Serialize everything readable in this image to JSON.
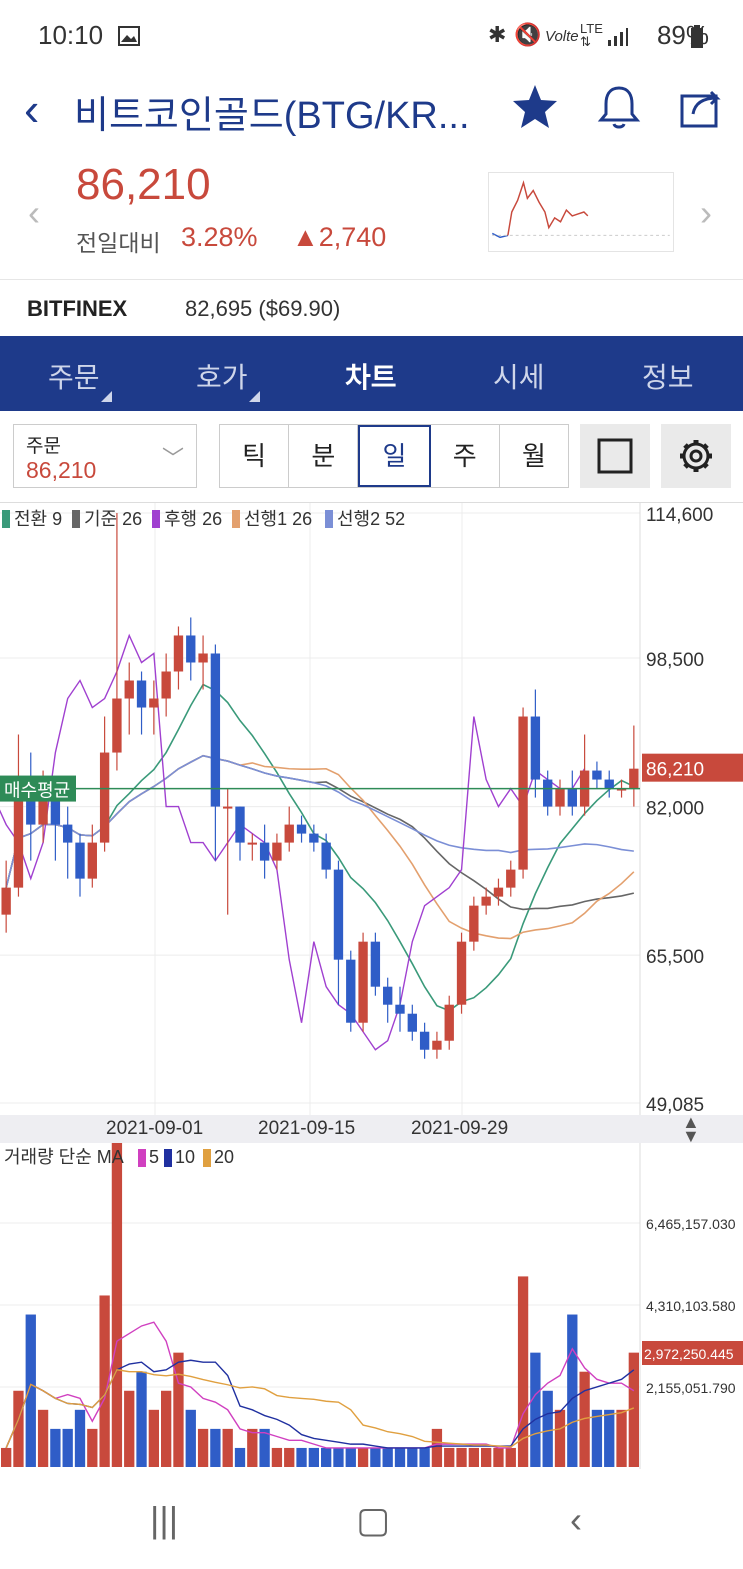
{
  "status_bar": {
    "time": "10:10",
    "battery": "89%",
    "icons": [
      "image-icon",
      "bluetooth-icon",
      "mute-icon",
      "volte-icon",
      "lte-icon",
      "signal-icon",
      "battery-icon"
    ]
  },
  "header": {
    "title": "비트코인골드(BTG/KR...",
    "icons": [
      "star-icon",
      "bell-icon",
      "share-icon"
    ]
  },
  "quote": {
    "price": "86,210",
    "change_label": "전일대비",
    "change_pct": "3.28%",
    "change_amount": "▲2,740",
    "up_color": "#c8493c",
    "down_color": "#2f5dc7"
  },
  "exchange": {
    "name": "BITFINEX",
    "value": "82,695 ($69.90)"
  },
  "tabs": [
    {
      "label": "주문"
    },
    {
      "label": "호가"
    },
    {
      "label": "차트"
    },
    {
      "label": "시세"
    },
    {
      "label": "정보"
    }
  ],
  "controls": {
    "order_label": "주문",
    "order_price": "86,210",
    "periods": [
      "틱",
      "분",
      "일",
      "주",
      "월"
    ],
    "selected_period": "일"
  },
  "price_chart": {
    "legend": [
      "전환 9",
      "기준 26",
      "후행 26",
      "선행1 26",
      "선행2 52"
    ],
    "y_labels": [
      "114,600",
      "98,500",
      "82,000",
      "65,500",
      "49,085"
    ],
    "current_price_label": "86,210",
    "avg_buy_label": "매수평균",
    "x_labels": [
      "2021-09-01",
      "2021-09-15",
      "2021-09-29"
    ]
  },
  "volume_chart": {
    "title": "거래량 단순 MA",
    "ma_labels": [
      "5",
      "10",
      "20"
    ],
    "y_labels": [
      "6,465,157.030",
      "4,310,103.580",
      "2,155,051.790"
    ],
    "current_label": "2,972,250.445"
  },
  "chart_data": {
    "type": "candlestick",
    "ylim": [
      49085,
      114600
    ],
    "candles": [
      [
        70000,
        73000,
        76000,
        68000
      ],
      [
        73000,
        84000,
        90000,
        72000
      ],
      [
        84000,
        80000,
        88000,
        76000
      ],
      [
        80000,
        83000,
        86000,
        78000
      ],
      [
        83000,
        80000,
        84000,
        76000
      ],
      [
        80000,
        78000,
        82000,
        74000
      ],
      [
        78000,
        74000,
        79000,
        72000
      ],
      [
        74000,
        78000,
        80000,
        73000
      ],
      [
        78000,
        88000,
        92000,
        77000
      ],
      [
        88000,
        94000,
        114600,
        86000
      ],
      [
        94000,
        96000,
        98000,
        90000
      ],
      [
        96000,
        93000,
        97000,
        90000
      ],
      [
        93000,
        94000,
        96000,
        90000
      ],
      [
        94000,
        97000,
        99000,
        92000
      ],
      [
        97000,
        101000,
        102000,
        95000
      ],
      [
        101000,
        98000,
        103000,
        96000
      ],
      [
        98000,
        99000,
        101000,
        95000
      ],
      [
        99000,
        82000,
        100000,
        76000
      ],
      [
        82000,
        82000,
        84000,
        70000
      ],
      [
        82000,
        78000,
        82000,
        76000
      ],
      [
        78000,
        78000,
        79000,
        76000
      ],
      [
        78000,
        76000,
        80000,
        74000
      ],
      [
        76000,
        78000,
        79000,
        75000
      ],
      [
        78000,
        80000,
        82000,
        77000
      ],
      [
        80000,
        79000,
        81000,
        78000
      ],
      [
        79000,
        78000,
        80000,
        77000
      ],
      [
        78000,
        75000,
        79000,
        74000
      ],
      [
        75000,
        65000,
        76000,
        60000
      ],
      [
        65000,
        58000,
        66000,
        57000
      ],
      [
        58000,
        67000,
        68000,
        57000
      ],
      [
        67000,
        62000,
        68000,
        61000
      ],
      [
        62000,
        60000,
        63000,
        58000
      ],
      [
        60000,
        59000,
        62000,
        57000
      ],
      [
        59000,
        57000,
        60000,
        56000
      ],
      [
        57000,
        55000,
        58000,
        54000
      ],
      [
        55000,
        56000,
        57000,
        54000
      ],
      [
        56000,
        60000,
        61000,
        55000
      ],
      [
        60000,
        67000,
        68000,
        59000
      ],
      [
        67000,
        71000,
        72000,
        66000
      ],
      [
        71000,
        72000,
        73000,
        70000
      ],
      [
        72000,
        73000,
        74000,
        71000
      ],
      [
        73000,
        75000,
        76000,
        72000
      ],
      [
        75000,
        92000,
        93000,
        74000
      ],
      [
        92000,
        85000,
        95000,
        83000
      ],
      [
        85000,
        82000,
        86000,
        81000
      ],
      [
        82000,
        84000,
        85000,
        81000
      ],
      [
        84000,
        82000,
        86000,
        81000
      ],
      [
        82000,
        86000,
        90000,
        81000
      ],
      [
        86000,
        85000,
        87000,
        84000
      ],
      [
        85000,
        84000,
        86000,
        83000
      ],
      [
        84000,
        84000,
        85000,
        83000
      ],
      [
        84000,
        86210,
        91000,
        82000
      ]
    ],
    "volume": [
      1,
      4,
      8,
      3,
      2,
      2,
      3,
      2,
      9,
      17,
      4,
      5,
      3,
      4,
      6,
      3,
      2,
      2,
      2,
      1,
      2,
      2,
      1,
      1,
      1,
      1,
      1,
      1,
      1,
      1,
      1,
      1,
      1,
      1,
      1,
      2,
      1,
      1,
      1,
      1,
      1,
      1,
      10,
      6,
      4,
      3,
      8,
      5,
      3,
      3,
      3,
      6
    ]
  }
}
